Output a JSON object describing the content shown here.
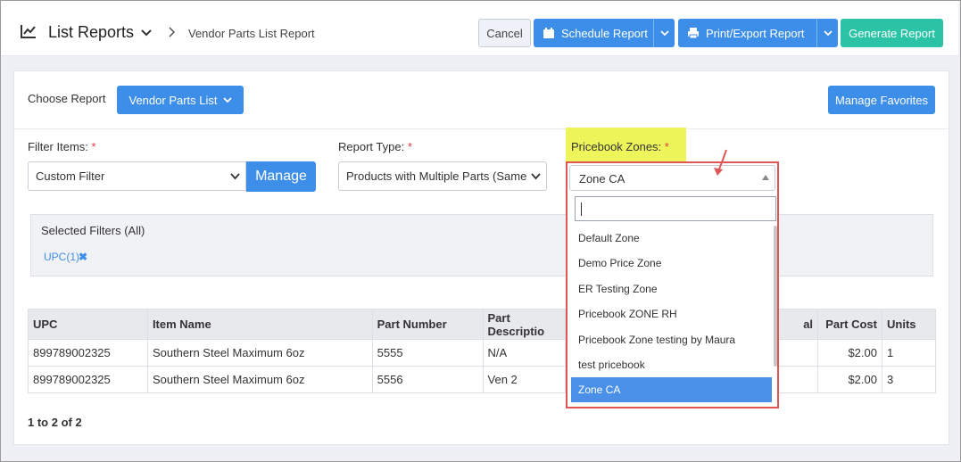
{
  "header": {
    "title": "List Reports",
    "breadcrumb": "Vendor Parts List Report",
    "cancel_label": "Cancel",
    "schedule_label": "Schedule Report",
    "print_label": "Print/Export Report",
    "generate_label": "Generate Report"
  },
  "report": {
    "choose_label": "Choose Report",
    "selected_report": "Vendor Parts List",
    "manage_favorites_label": "Manage Favorites"
  },
  "filter_items": {
    "label": "Filter Items:",
    "required": "*",
    "value": "Custom Filter",
    "manage_label": "Manage"
  },
  "report_type": {
    "label": "Report Type:",
    "required": "*",
    "value": "Products with Multiple Parts (Same"
  },
  "pricebook_zones": {
    "label": "Pricebook Zones:",
    "required": "*",
    "value": "Zone CA",
    "search_value": "",
    "options": [
      "Default Zone",
      "Demo Price Zone",
      "ER Testing Zone",
      "Pricebook ZONE RH",
      "Pricebook Zone testing by Maura",
      "test pricebook",
      "Zone CA"
    ],
    "selected_index": 6
  },
  "selected_filters": {
    "title": "Selected Filters (All)",
    "chips": [
      {
        "label": "UPC(1)",
        "remove": "✖"
      }
    ]
  },
  "table": {
    "columns": [
      "UPC",
      "Item Name",
      "Part Number",
      "Part Descriptio",
      "al",
      "Part Cost",
      "Units"
    ],
    "rows": [
      [
        "899789002325",
        "Southern Steel Maximum 6oz",
        "5555",
        "N/A",
        "",
        "$2.00",
        "1"
      ],
      [
        "899789002325",
        "Southern Steel Maximum 6oz",
        "5556",
        "Ven 2",
        "",
        "$2.00",
        "3"
      ]
    ]
  },
  "pager": "1 to 2 of 2",
  "colors": {
    "primary": "#3d8ee9",
    "generate": "#2bc3a5",
    "highlight": "#eef55a",
    "callout": "#e05555",
    "selected_option": "#4a90e8"
  },
  "icons": [
    "chart-line-icon",
    "chevron-down-icon",
    "chevron-right-icon",
    "calendar-icon",
    "print-icon",
    "caret-down-icon",
    "caret-up-icon",
    "close-icon",
    "arrow-icon"
  ]
}
